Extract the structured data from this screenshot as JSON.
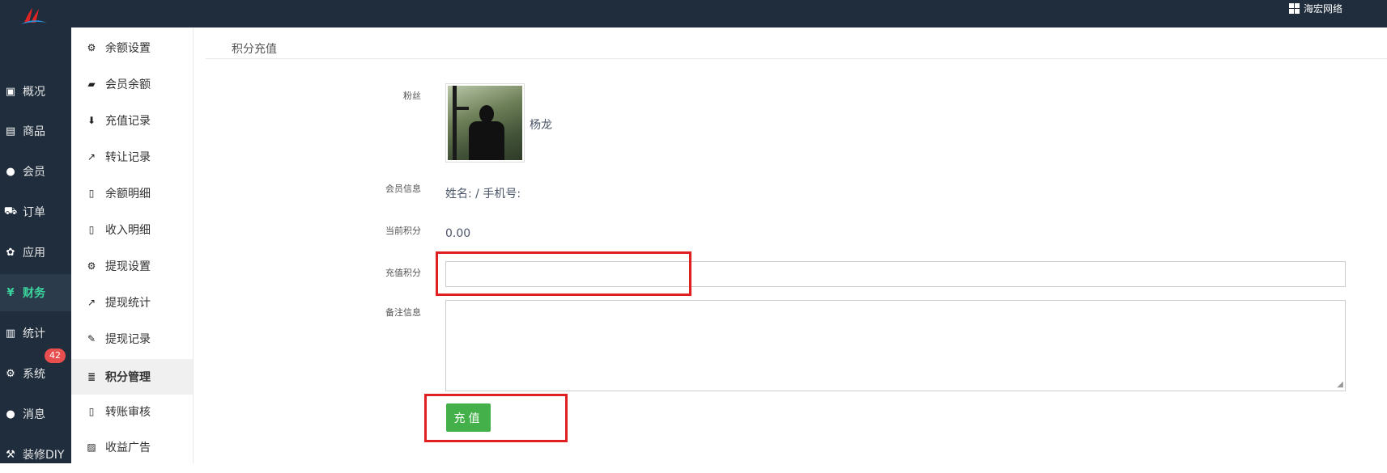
{
  "topbar": {
    "brand_label": "海宏网络"
  },
  "leftnav": [
    {
      "label": "概况",
      "icon": "dashboard-icon"
    },
    {
      "label": "商品",
      "icon": "box-icon"
    },
    {
      "label": "会员",
      "icon": "users-icon"
    },
    {
      "label": "订单",
      "icon": "cart-icon"
    },
    {
      "label": "应用",
      "icon": "apps-icon"
    },
    {
      "label": "财务",
      "icon": "yen-icon",
      "active": true
    },
    {
      "label": "统计",
      "icon": "bar-chart-icon"
    },
    {
      "label": "系统",
      "icon": "gears-icon"
    },
    {
      "label": "消息",
      "icon": "comment-icon",
      "badge": "42"
    },
    {
      "label": "装修DIY",
      "icon": "gavel-icon"
    }
  ],
  "subnav": [
    {
      "label": "余额设置",
      "icon": "gear-icon"
    },
    {
      "label": "会员余额",
      "icon": "book-icon"
    },
    {
      "label": "充值记录",
      "icon": "download-icon"
    },
    {
      "label": "转让记录",
      "icon": "external-link-icon"
    },
    {
      "label": "余额明细",
      "icon": "file-icon"
    },
    {
      "label": "收入明细",
      "icon": "file-icon"
    },
    {
      "label": "提现设置",
      "icon": "gear-icon"
    },
    {
      "label": "提现统计",
      "icon": "line-chart-icon"
    },
    {
      "label": "提现记录",
      "icon": "pencil-icon"
    },
    {
      "label": "积分管理",
      "icon": "database-icon",
      "active": true
    },
    {
      "label": "转账审核",
      "icon": "file-icon"
    },
    {
      "label": "收益广告",
      "icon": "image-icon"
    }
  ],
  "content": {
    "title": "积分充值",
    "fan_label": "粉丝",
    "fan_name": "杨龙",
    "member_info_label": "会员信息",
    "member_info_value": "姓名: / 手机号:",
    "current_points_label": "当前积分",
    "current_points_value": "0.00",
    "recharge_points_label": "充值积分",
    "recharge_points_value": "",
    "remark_label": "备注信息",
    "remark_value": "",
    "submit_label": "充值"
  },
  "colors": {
    "sidebar_bg": "#1f2d3d",
    "active_nav": "#3bd49c",
    "button_green": "#43b049",
    "highlight_red": "#e02020",
    "badge_red": "#e94e4e"
  }
}
